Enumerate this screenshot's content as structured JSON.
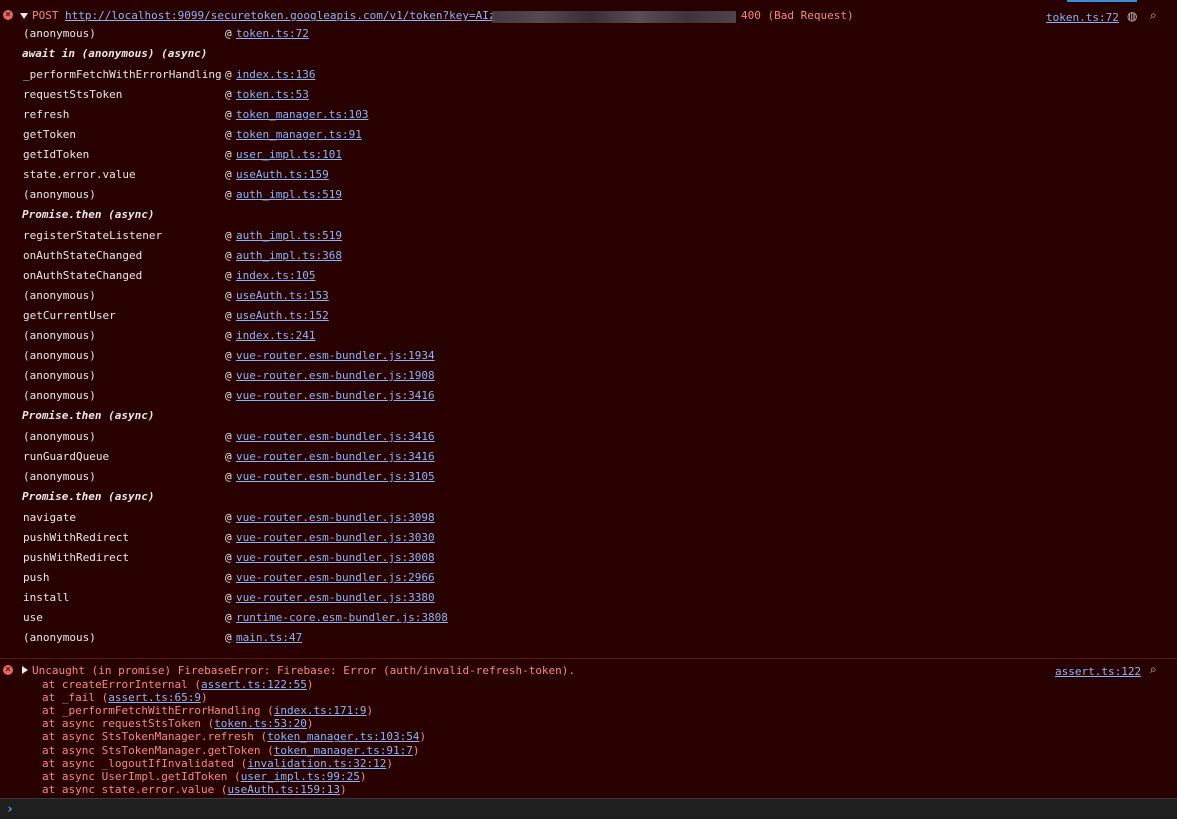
{
  "colors": {
    "background": "#290000",
    "error_text": "#f28b82",
    "link": "#8ab4f8",
    "text": "#e8e8e8",
    "error_icon": "#e46962",
    "prompt": "#4da3ff"
  },
  "request": {
    "method": "POST",
    "url": "http://localhost:9099/securetoken.googleapis.com/v1/token?key=AIz",
    "status": "400 (Bad Request)",
    "source": "token.ts:72",
    "icons": [
      "network-request-icon",
      "search-icon"
    ]
  },
  "stack": [
    {
      "type": "frame",
      "fn": "(anonymous)",
      "loc": "token.ts:72"
    },
    {
      "type": "async",
      "text": "await in (anonymous) (async)"
    },
    {
      "type": "frame",
      "fn": "_performFetchWithErrorHandling",
      "loc": "index.ts:136"
    },
    {
      "type": "frame",
      "fn": "requestStsToken",
      "loc": "token.ts:53"
    },
    {
      "type": "frame",
      "fn": "refresh",
      "loc": "token_manager.ts:103"
    },
    {
      "type": "frame",
      "fn": "getToken",
      "loc": "token_manager.ts:91"
    },
    {
      "type": "frame",
      "fn": "getIdToken",
      "loc": "user_impl.ts:101"
    },
    {
      "type": "frame",
      "fn": "state.error.value",
      "loc": "useAuth.ts:159"
    },
    {
      "type": "frame",
      "fn": "(anonymous)",
      "loc": "auth_impl.ts:519"
    },
    {
      "type": "async",
      "text": "Promise.then (async)"
    },
    {
      "type": "frame",
      "fn": "registerStateListener",
      "loc": "auth_impl.ts:519"
    },
    {
      "type": "frame",
      "fn": "onAuthStateChanged",
      "loc": "auth_impl.ts:368"
    },
    {
      "type": "frame",
      "fn": "onAuthStateChanged",
      "loc": "index.ts:105"
    },
    {
      "type": "frame",
      "fn": "(anonymous)",
      "loc": "useAuth.ts:153"
    },
    {
      "type": "frame",
      "fn": "getCurrentUser",
      "loc": "useAuth.ts:152"
    },
    {
      "type": "frame",
      "fn": "(anonymous)",
      "loc": "index.ts:241"
    },
    {
      "type": "frame",
      "fn": "(anonymous)",
      "loc": "vue-router.esm-bundler.js:1934"
    },
    {
      "type": "frame",
      "fn": "(anonymous)",
      "loc": "vue-router.esm-bundler.js:1908"
    },
    {
      "type": "frame",
      "fn": "(anonymous)",
      "loc": "vue-router.esm-bundler.js:3416"
    },
    {
      "type": "async",
      "text": "Promise.then (async)"
    },
    {
      "type": "frame",
      "fn": "(anonymous)",
      "loc": "vue-router.esm-bundler.js:3416"
    },
    {
      "type": "frame",
      "fn": "runGuardQueue",
      "loc": "vue-router.esm-bundler.js:3416"
    },
    {
      "type": "frame",
      "fn": "(anonymous)",
      "loc": "vue-router.esm-bundler.js:3105"
    },
    {
      "type": "async",
      "text": "Promise.then (async)"
    },
    {
      "type": "frame",
      "fn": "navigate",
      "loc": "vue-router.esm-bundler.js:3098"
    },
    {
      "type": "frame",
      "fn": "pushWithRedirect",
      "loc": "vue-router.esm-bundler.js:3030"
    },
    {
      "type": "frame",
      "fn": "pushWithRedirect",
      "loc": "vue-router.esm-bundler.js:3008"
    },
    {
      "type": "frame",
      "fn": "push",
      "loc": "vue-router.esm-bundler.js:2966"
    },
    {
      "type": "frame",
      "fn": "install",
      "loc": "vue-router.esm-bundler.js:3380"
    },
    {
      "type": "frame",
      "fn": "use",
      "loc": "runtime-core.esm-bundler.js:3808"
    },
    {
      "type": "frame",
      "fn": "(anonymous)",
      "loc": "main.ts:47"
    }
  ],
  "error": {
    "message": "Uncaught (in promise) FirebaseError: Firebase: Error (auth/invalid-refresh-token).",
    "source": "assert.ts:122",
    "trace": [
      {
        "prefix": "at createErrorInternal (",
        "loc": "assert.ts:122:55",
        "suffix": ")"
      },
      {
        "prefix": "at _fail (",
        "loc": "assert.ts:65:9",
        "suffix": ")"
      },
      {
        "prefix": "at _performFetchWithErrorHandling (",
        "loc": "index.ts:171:9",
        "suffix": ")"
      },
      {
        "prefix": "at async requestStsToken (",
        "loc": "token.ts:53:20",
        "suffix": ")"
      },
      {
        "prefix": "at async StsTokenManager.refresh (",
        "loc": "token_manager.ts:103:54",
        "suffix": ")"
      },
      {
        "prefix": "at async StsTokenManager.getToken (",
        "loc": "token_manager.ts:91:7",
        "suffix": ")"
      },
      {
        "prefix": "at async _logoutIfInvalidated (",
        "loc": "invalidation.ts:32:12",
        "suffix": ")"
      },
      {
        "prefix": "at async UserImpl.getIdToken (",
        "loc": "user_impl.ts:99:25",
        "suffix": ")"
      },
      {
        "prefix": "at async state.error.value (",
        "loc": "useAuth.ts:159:13",
        "suffix": ")"
      }
    ]
  },
  "prompt": {
    "symbol": "›"
  }
}
